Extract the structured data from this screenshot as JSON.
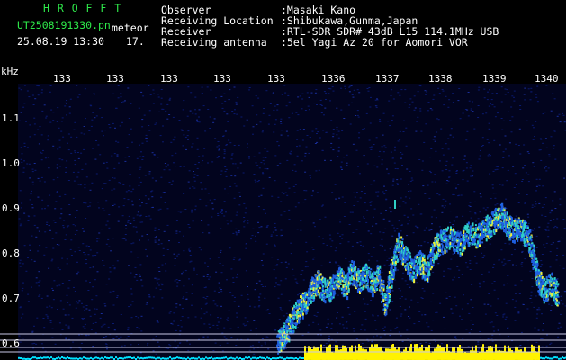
{
  "header": {
    "app_name": "H R O F F T",
    "file_name": "UT2508191330.pn",
    "file_type": "meteor",
    "datetime": "25.08.19 13:30",
    "index": "17.",
    "fields": [
      {
        "label": "Observer",
        "value": ":Masaki Kano"
      },
      {
        "label": "Receiving Location",
        "value": ":Shibukawa,Gunma,Japan"
      },
      {
        "label": "Receiver",
        "value": ":RTL-SDR SDR# 43dB L15 114.1MHz USB"
      },
      {
        "label": "Receiving antenna",
        "value": ":5el Yagi Az 20 for Aomori VOR"
      }
    ]
  },
  "spectrogram": {
    "y_unit": "kHz",
    "y_ticks": [
      "1.1",
      "1.0",
      "0.9",
      "0.8",
      "0.7",
      "0.6"
    ],
    "x_ticks": [
      "133",
      "133",
      "133",
      "133",
      "133",
      "1336",
      "1337",
      "1338",
      "1339",
      "1340"
    ],
    "colors": {
      "background": "#000000",
      "noise": "#0a1a6e",
      "signal_low": "#1f5fe0",
      "signal_mid": "#2fd0c8",
      "signal_high": "#e8f040",
      "strip": "#fff200",
      "baseline": "#00e0ff"
    }
  }
}
